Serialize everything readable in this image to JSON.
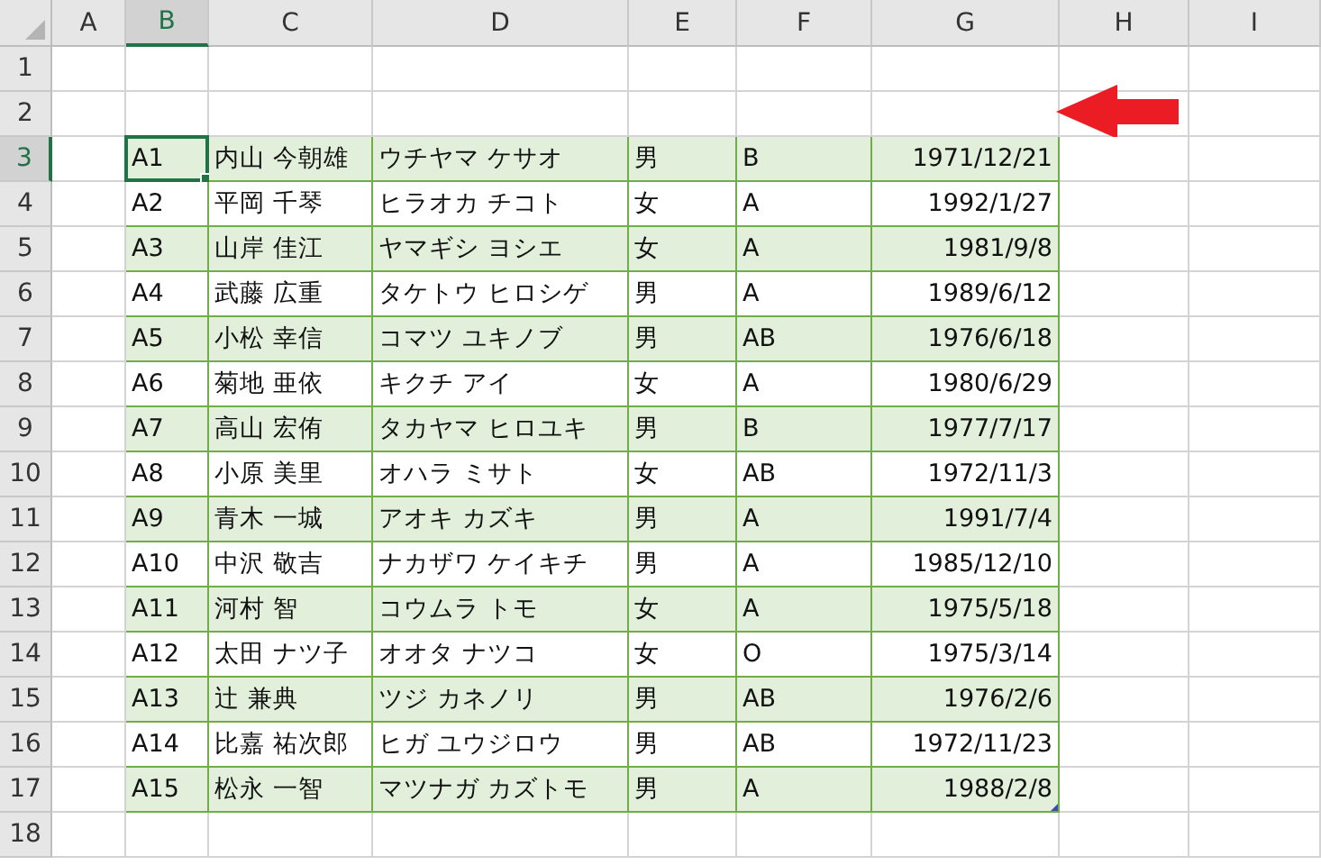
{
  "columns": [
    {
      "label": "A",
      "selected": false
    },
    {
      "label": "B",
      "selected": true
    },
    {
      "label": "C",
      "selected": false
    },
    {
      "label": "D",
      "selected": false
    },
    {
      "label": "E",
      "selected": false
    },
    {
      "label": "F",
      "selected": false
    },
    {
      "label": "G",
      "selected": false
    },
    {
      "label": "H",
      "selected": false
    },
    {
      "label": "I",
      "selected": false
    }
  ],
  "row_headers": [
    {
      "label": "1",
      "selected": false
    },
    {
      "label": "2",
      "selected": false
    },
    {
      "label": "3",
      "selected": true
    },
    {
      "label": "4",
      "selected": false
    },
    {
      "label": "5",
      "selected": false
    },
    {
      "label": "6",
      "selected": false
    },
    {
      "label": "7",
      "selected": false
    },
    {
      "label": "8",
      "selected": false
    },
    {
      "label": "9",
      "selected": false
    },
    {
      "label": "10",
      "selected": false
    },
    {
      "label": "11",
      "selected": false
    },
    {
      "label": "12",
      "selected": false
    },
    {
      "label": "13",
      "selected": false
    },
    {
      "label": "14",
      "selected": false
    },
    {
      "label": "15",
      "selected": false
    },
    {
      "label": "16",
      "selected": false
    },
    {
      "label": "17",
      "selected": false
    },
    {
      "label": "18",
      "selected": false
    }
  ],
  "table": {
    "rows": [
      {
        "banded": true,
        "first_cell_selected": true,
        "cells": [
          "A1",
          "内山 今朝雄",
          "ウチヤマ ケサオ",
          "男",
          "B",
          "1971/12/21"
        ]
      },
      {
        "banded": false,
        "first_cell_selected": false,
        "cells": [
          "A2",
          "平岡 千琴",
          "ヒラオカ チコト",
          "女",
          "A",
          "1992/1/27"
        ]
      },
      {
        "banded": true,
        "first_cell_selected": false,
        "cells": [
          "A3",
          "山岸 佳江",
          "ヤマギシ ヨシエ",
          "女",
          "A",
          "1981/9/8"
        ]
      },
      {
        "banded": false,
        "first_cell_selected": false,
        "cells": [
          "A4",
          "武藤 広重",
          "タケトウ ヒロシゲ",
          "男",
          "A",
          "1989/6/12"
        ]
      },
      {
        "banded": true,
        "first_cell_selected": false,
        "cells": [
          "A5",
          "小松 幸信",
          "コマツ ユキノブ",
          "男",
          "AB",
          "1976/6/18"
        ]
      },
      {
        "banded": false,
        "first_cell_selected": false,
        "cells": [
          "A6",
          "菊地 亜依",
          "キクチ アイ",
          "女",
          "A",
          "1980/6/29"
        ]
      },
      {
        "banded": true,
        "first_cell_selected": false,
        "cells": [
          "A7",
          "高山 宏侑",
          "タカヤマ ヒロユキ",
          "男",
          "B",
          "1977/7/17"
        ]
      },
      {
        "banded": false,
        "first_cell_selected": false,
        "cells": [
          "A8",
          "小原 美里",
          "オハラ ミサト",
          "女",
          "AB",
          "1972/11/3"
        ]
      },
      {
        "banded": true,
        "first_cell_selected": false,
        "cells": [
          "A9",
          "青木 一城",
          "アオキ カズキ",
          "男",
          "A",
          "1991/7/4"
        ]
      },
      {
        "banded": false,
        "first_cell_selected": false,
        "cells": [
          "A10",
          "中沢 敬吉",
          "ナカザワ ケイキチ",
          "男",
          "A",
          "1985/12/10"
        ]
      },
      {
        "banded": true,
        "first_cell_selected": false,
        "cells": [
          "A11",
          "河村 智",
          "コウムラ トモ",
          "女",
          "A",
          "1975/5/18"
        ]
      },
      {
        "banded": false,
        "first_cell_selected": false,
        "cells": [
          "A12",
          "太田 ナツ子",
          "オオタ ナツコ",
          "女",
          "O",
          "1975/3/14"
        ]
      },
      {
        "banded": true,
        "first_cell_selected": false,
        "cells": [
          "A13",
          "辻 兼典",
          "ツジ カネノリ",
          "男",
          "AB",
          "1976/2/6"
        ]
      },
      {
        "banded": false,
        "first_cell_selected": false,
        "cells": [
          "A14",
          "比嘉 祐次郎",
          "ヒガ ユウジロウ",
          "男",
          "AB",
          "1972/11/23"
        ]
      },
      {
        "banded": true,
        "first_cell_selected": false,
        "cells": [
          "A15",
          "松永 一智",
          "マツナガ カズトモ",
          "男",
          "A",
          "1988/2/8"
        ]
      }
    ]
  }
}
